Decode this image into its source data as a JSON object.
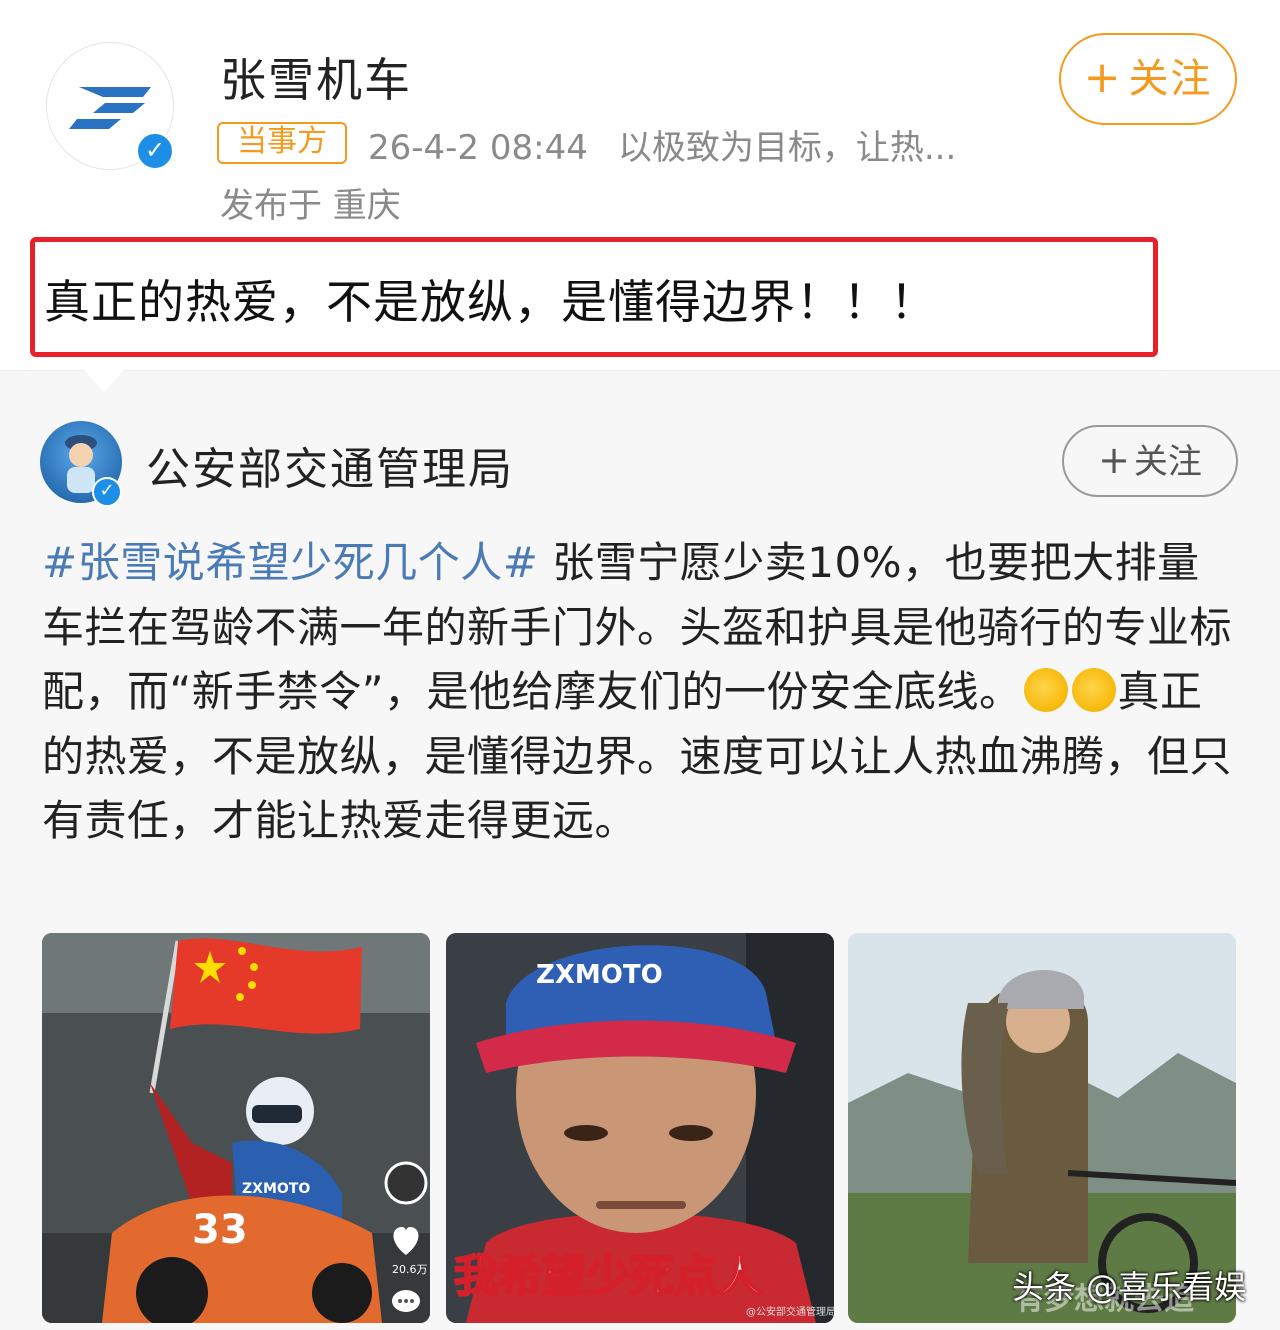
{
  "post": {
    "account_name": "张雪机车",
    "follow_label": "关注",
    "role_badge": "当事方",
    "timestamp": "26-4-2 08:44",
    "source_text": "以极致为目标，让热...",
    "location": "发布于 重庆",
    "headline": "真正的热爱，不是放纵，是懂得边界！！！"
  },
  "repost": {
    "account_name": "公安部交通管理局",
    "follow_label": "关注",
    "hashtag": "#张雪说希望少死几个人#",
    "body_1": " 张雪宁愿少卖10%，也要把大排量车拦在驾龄不满一年的新手门外。头盔和护具是他骑行的专业标配，而“新手禁令”，是他给摩友们的一份安全底线。",
    "body_2": "真正的热爱，不是放纵，是懂得边界。速度可以让人热血沸腾，但只有责任，才能让热爱走得更远。",
    "images": [
      {
        "like_count": "20.6万",
        "helmet_text": "ZXMOTO"
      },
      {
        "cap_text": "ZXMOTO",
        "caption": "我希望少死点人",
        "credit": "@公安部交通管理局"
      },
      {
        "caption_faded": "有梦想就去追"
      }
    ]
  },
  "watermark": "头条 @喜乐看娱",
  "colors": {
    "accent_orange": "#f39a1f",
    "highlight_red": "#e7202a",
    "hashtag_blue": "#4a7bb7",
    "verified_blue": "#1e8fe6"
  },
  "icons": [
    "brand-logo-icon",
    "verified-icon",
    "plus-icon",
    "emoji-icon",
    "heart-icon",
    "comment-icon"
  ]
}
